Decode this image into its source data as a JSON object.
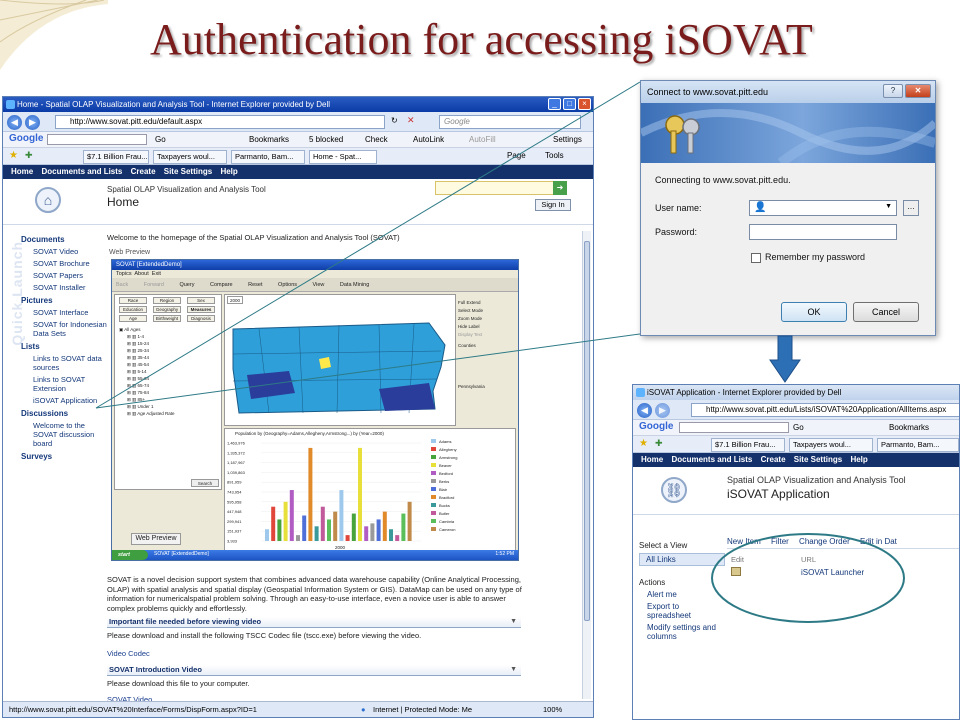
{
  "slide": {
    "title": "Authentication for accessing iSOVAT"
  },
  "main_window": {
    "title": "Home - Spatial OLAP Visualization and Analysis Tool - Internet Explorer provided by Dell",
    "url": "http://www.sovat.pitt.edu/default.aspx",
    "search_placeholder": "Google",
    "google_bar": {
      "logo": "Google",
      "go": "Go",
      "bookmarks": "Bookmarks",
      "blocked": "5 blocked",
      "check": "Check",
      "autolink": "AutoLink",
      "autofill": "AutoFill",
      "settings": "Settings"
    },
    "tabs": [
      "$7.1 Billion Frau...",
      "Taxpayers woul...",
      "Parmanto, Bam...",
      "Home - Spat..."
    ],
    "page_menu": "Page",
    "tools_menu": "Tools",
    "topnav": [
      "Home",
      "Documents and Lists",
      "Create",
      "Site Settings",
      "Help"
    ],
    "site_subtitle": "Spatial OLAP Visualization and Analysis Tool",
    "site_title": "Home",
    "sign_in": "Sign In",
    "quick_launch_watermark": "Quick Launch",
    "quick_launch": [
      {
        "head": "Documents",
        "items": [
          "SOVAT Video",
          "SOVAT Brochure",
          "SOVAT Papers",
          "SOVAT Installer"
        ]
      },
      {
        "head": "Pictures",
        "items": [
          "SOVAT Interface",
          "SOVAT for Indonesian Data Sets"
        ]
      },
      {
        "head": "Lists",
        "items": [
          "Links to SOVAT data sources",
          "Links to SOVAT Extension",
          "iSOVAT Application"
        ]
      },
      {
        "head": "Discussions",
        "items": [
          "Welcome to the SOVAT discussion board"
        ]
      },
      {
        "head": "Surveys",
        "items": []
      }
    ],
    "welcome": "Welcome to the homepage of the Spatial OLAP Visualization and Analysis Tool (SOVAT)",
    "web_preview_label": "Web Preview",
    "web_preview_button": "Web Preview",
    "description": "SOVAT is a novel decision support system that combines advanced data warehouse capability (Online Analytical Processing, OLAP) with spatial analysis and spatial display (Geospatial Information System or GIS). DataMap can be used on any type of information for numericalspatial problem solving. Through an easy-to-use interface, even a novice user is able to answer complex problems quickly and effortlessly.",
    "important_header": "Important file needed before viewing video",
    "important_text": "Please download and install the following TSCC Codec file (tscc.exe) before viewing the video.",
    "video_codec_link": "Video Codec",
    "intro_header": "SOVAT Introduction Video",
    "intro_text": "Please download this file to your computer.",
    "sovat_video_link": "SOVAT Video",
    "status_url": "http://www.sovat.pitt.edu/SOVAT%20Interface/Forms/DispForm.aspx?ID=1",
    "status_zone": "Internet | Protected Mode: Me",
    "zoom": "100%"
  },
  "inner_app": {
    "title": "SOVAT [ExtendedDemo]",
    "menu": [
      "Topics",
      "About",
      "Exit"
    ],
    "tools": [
      "Back",
      "Forward",
      "Query",
      "Compare",
      "Reset",
      "Options",
      "View",
      "Data Mining"
    ],
    "dims": [
      "Race",
      "Region",
      "Sex",
      "Education",
      "Geography",
      "Measures",
      "Age",
      "Birthweight",
      "Diagnosis"
    ],
    "tree": [
      "All Ages",
      "1-4",
      "15-24",
      "25-34",
      "35-44",
      "45-54",
      "5-14",
      "55-64",
      "65-74",
      "75-84",
      "85+",
      "Under 1",
      "Age Adjusted Rate"
    ],
    "year_tab": "2000",
    "search_btn": "Search",
    "legend": [
      "Full Extend",
      "Select Mode",
      "Zoom Mode",
      "Hide Label",
      "Display Text",
      "Counties",
      "Pennsylvania"
    ],
    "chart_title": "Population by (Geography=Adams,Allegheny,Armstrong...) by (Year=2000)",
    "chart_x_label": "2000",
    "y_ticks": [
      "1,463,976",
      "1,335,372",
      "1,187,967",
      "1,039,863",
      "891,959",
      "743,954",
      "595,958",
      "447,948",
      "299,941",
      "151,937",
      "3,933"
    ],
    "series": [
      "Adams",
      "Allegheny",
      "Armstrong",
      "Beaver",
      "Bedford",
      "Berks",
      "Blair",
      "Bradford",
      "Bucks",
      "Butler",
      "Cambria",
      "Cameron"
    ],
    "start": "start",
    "task": "SOVAT [ExtendedDemo]",
    "clock": "1:52 PM"
  },
  "dialog": {
    "title": "Connect to www.sovat.pitt.edu",
    "connecting": "Connecting to www.sovat.pitt.edu.",
    "username_label": "User name:",
    "password_label": "Password:",
    "remember": "Remember my password",
    "ok": "OK",
    "cancel": "Cancel"
  },
  "isovat_window": {
    "title": "iSOVAT Application - Internet Explorer provided by Dell",
    "url": "http://www.sovat.pitt.edu/Lists/iSOVAT%20Application/AllItems.aspx",
    "google_logo": "Google",
    "go": "Go",
    "bookmarks": "Bookmarks",
    "tabs": [
      "$7.1 Billion Frau...",
      "Taxpayers woul...",
      "Parmanto, Bam..."
    ],
    "topnav": [
      "Home",
      "Documents and Lists",
      "Create",
      "Site Settings",
      "Help"
    ],
    "site_subtitle": "Spatial OLAP Visualization and Analysis Tool",
    "site_title": "iSOVAT Application",
    "select_view": "Select a View",
    "all_links": "All Links",
    "actions": "Actions",
    "action_items": [
      "Alert me",
      "Export to spreadsheet",
      "Modify settings and columns"
    ],
    "toolbar": [
      "New Item",
      "Filter",
      "Change Order",
      "Edit in Dat"
    ],
    "col_edit": "Edit",
    "col_url": "URL",
    "row_link": "iSOVAT Launcher"
  },
  "colors": {
    "title": "#7a1c1c",
    "sp_nav": "#15316b",
    "link": "#14387a",
    "arrow": "#2d6fb5",
    "callout": "#2d7a86"
  }
}
